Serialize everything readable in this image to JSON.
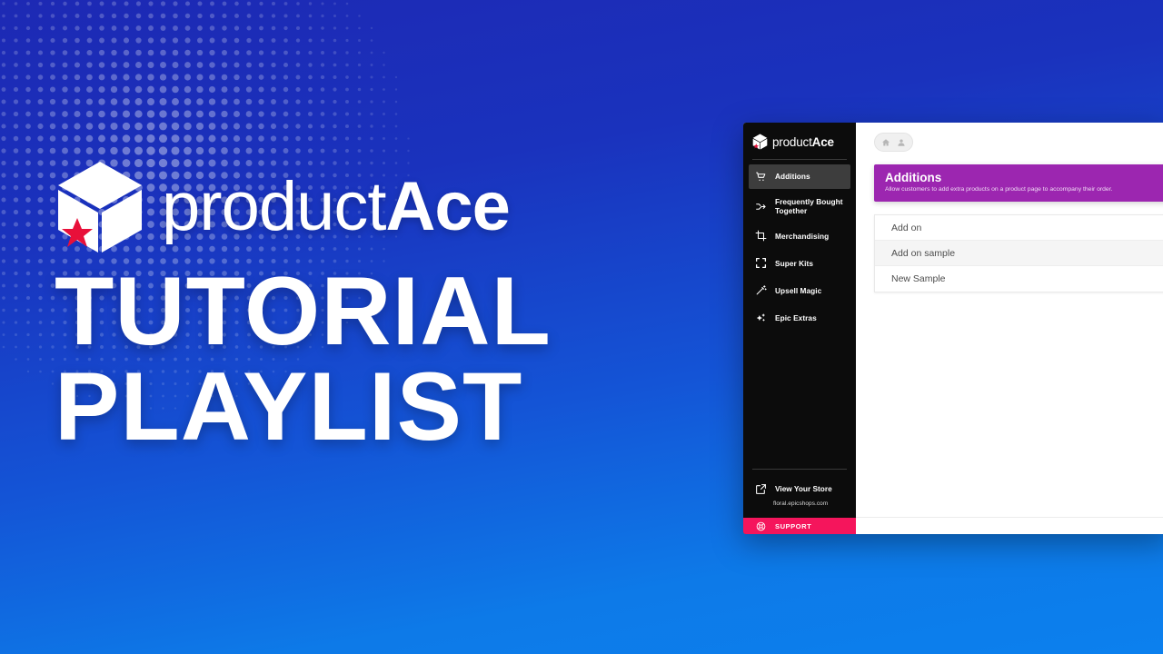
{
  "promo": {
    "logo_icon": "cube-star-logo-icon",
    "brand_light": "product",
    "brand_bold": "Ace",
    "headline_line1": "TUTORIAL",
    "headline_line2": "PLAYLIST"
  },
  "background": {
    "gradient_top": "#1d29b4",
    "gradient_bottom": "#0c80ee",
    "dot_pattern": "halftone-dots"
  },
  "app": {
    "sidebar": {
      "brand_icon": "cube-star-logo-icon",
      "brand_light": "product",
      "brand_bold": "Ace",
      "items": [
        {
          "label": "Additions",
          "icon": "shopping-cart-icon",
          "active": true
        },
        {
          "label": "Frequently Bought Together",
          "icon": "merge-arrow-icon",
          "active": false
        },
        {
          "label": "Merchandising",
          "icon": "crop-icon",
          "active": false
        },
        {
          "label": "Super Kits",
          "icon": "fullscreen-corners-icon",
          "active": false
        },
        {
          "label": "Upsell Magic",
          "icon": "magic-wand-icon",
          "active": false
        },
        {
          "label": "Epic Extras",
          "icon": "sparkles-icon",
          "active": false
        }
      ],
      "store": {
        "icon": "external-link-icon",
        "label": "View Your Store",
        "url": "floral.epicshops.com"
      },
      "support": {
        "icon": "lifebuoy-icon",
        "label": "SUPPORT",
        "color": "#f5155c"
      }
    },
    "main": {
      "breadcrumb": {
        "home_icon": "home-icon",
        "user_icon": "person-icon"
      },
      "banner": {
        "title": "Additions",
        "subtitle": "Allow customers to add extra products on a product page to accompany their order.",
        "color": "#9c26b0"
      },
      "list": {
        "rows": [
          {
            "label": "Add on"
          },
          {
            "label": "Add on sample"
          },
          {
            "label": "New Sample"
          }
        ]
      }
    }
  }
}
